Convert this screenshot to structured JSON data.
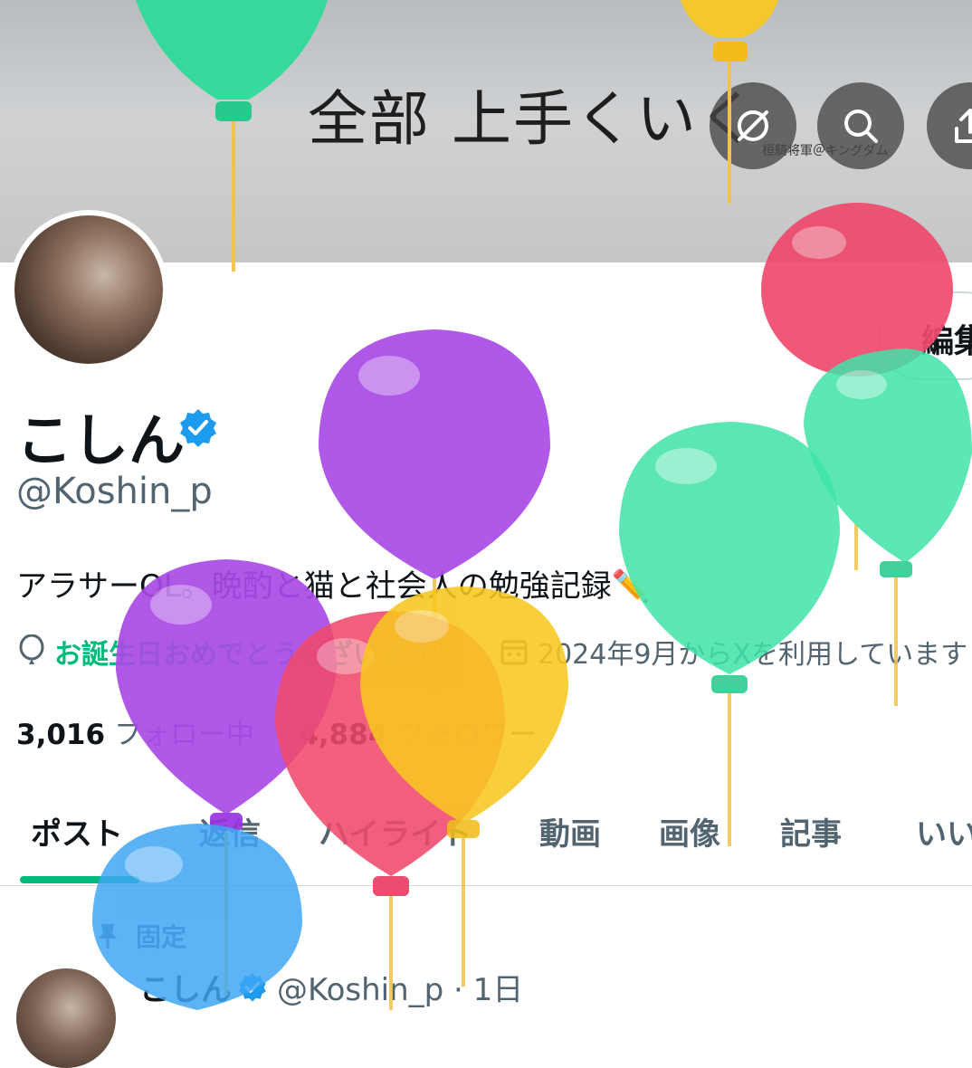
{
  "banner": {
    "text": "全部 上手くいく",
    "sub": "桓騎将軍＠キングダム"
  },
  "header_buttons": [
    {
      "name": "grok-icon"
    },
    {
      "name": "search-icon"
    },
    {
      "name": "share-icon"
    }
  ],
  "profile": {
    "edit_label": "編集",
    "display_name": "こしん",
    "handle": "@Koshin_p",
    "bio": "アラサーOL。晩酌と猫と社会人の勉強記録✏️",
    "birthday_text": "お誕生日おめでとうございます！",
    "joined_text": "2024年9月からXを利用しています",
    "following_count": "3,016",
    "following_label": "フォロー中",
    "followers_count": "4,884",
    "followers_label": "フォロワー"
  },
  "tabs": [
    "ポスト",
    "返信",
    "ハイライト",
    "動画",
    "画像",
    "記事",
    "いいね"
  ],
  "active_tab": "ポスト",
  "post": {
    "pinned_label": "固定",
    "name": "こしん",
    "handle_time": "@Koshin_p · 1日"
  },
  "colors": {
    "accent_green": "#00ba7c",
    "verified_blue": "#1d9bf0",
    "secondary_text": "#536471"
  }
}
